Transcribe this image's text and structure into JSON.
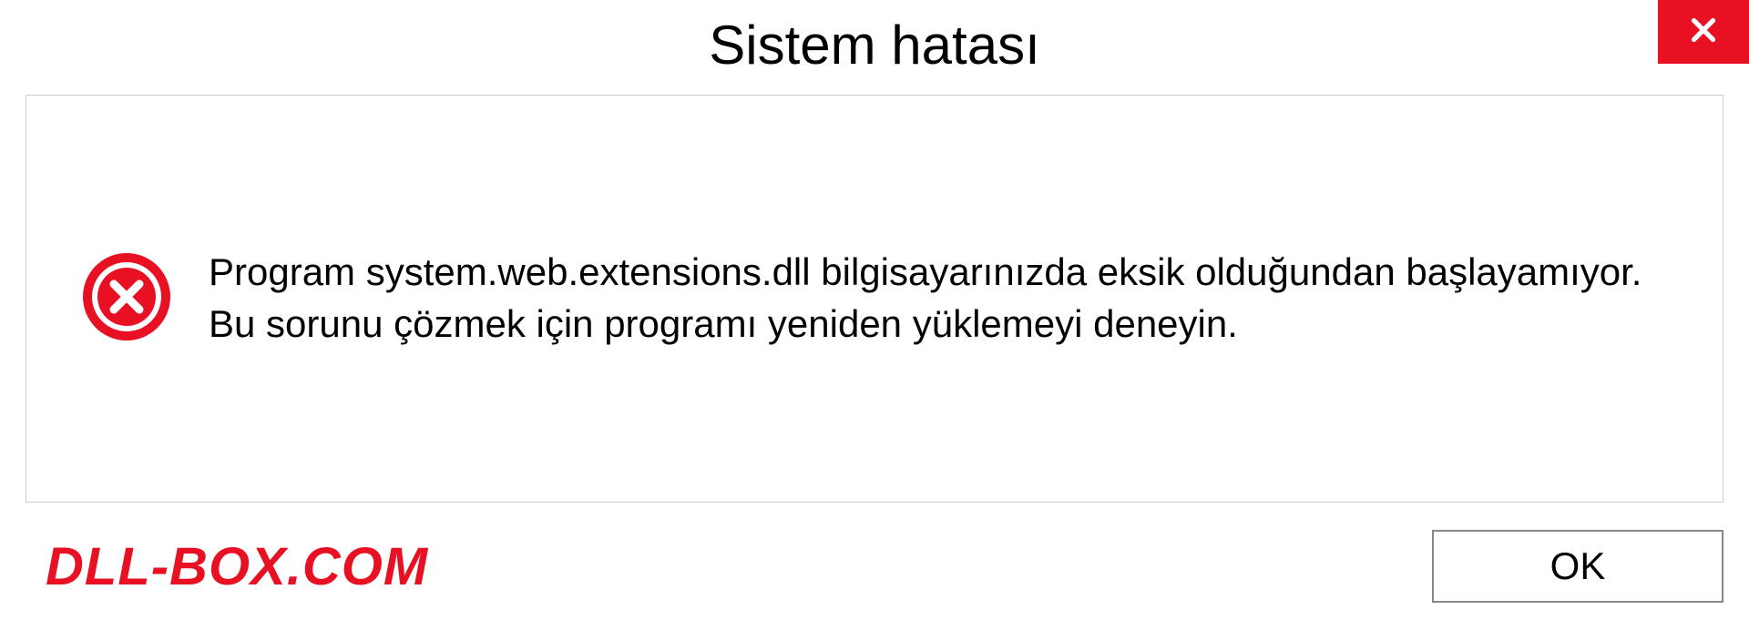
{
  "dialog": {
    "title": "Sistem hatası",
    "message": "Program system.web.extensions.dll bilgisayarınızda eksik olduğundan başlayamıyor. Bu sorunu çözmek için programı yeniden yüklemeyi deneyin.",
    "ok_label": "OK"
  },
  "watermark": "DLL-BOX.COM",
  "colors": {
    "error_red": "#e81123",
    "border_gray": "#cccccc"
  }
}
